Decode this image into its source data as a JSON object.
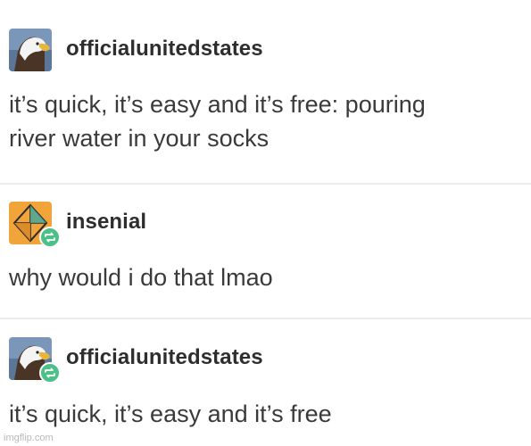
{
  "posts": [
    {
      "username": "officialunitedstates",
      "avatar_icon": "eagle-icon",
      "lines": [
        "it’s quick, it’s easy and it’s free: pouring",
        "river water in your socks"
      ]
    },
    {
      "username": "insenial",
      "avatar_icon": "geometric-diamond-icon",
      "reblog_icon": "reblog-icon",
      "lines": [
        "why would i do that lmao"
      ]
    },
    {
      "username": "officialunitedstates",
      "avatar_icon": "eagle-icon",
      "reblog_icon": "reblog-icon",
      "lines": [
        "it’s quick, it’s easy and it’s free"
      ]
    }
  ],
  "watermark": "imgflip.com",
  "colors": {
    "reblog_badge": "#4dc08a",
    "divider": "#ececec",
    "text": "#3a3a3a",
    "username": "#2e2e2e"
  }
}
